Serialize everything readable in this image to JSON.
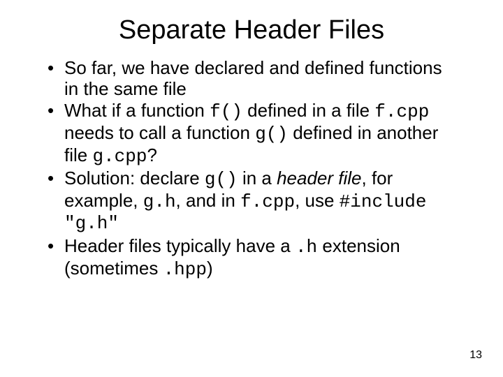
{
  "title": "Separate Header Files",
  "bullets": {
    "b1": {
      "t1": "So far, we have declared and defined functions in the same file"
    },
    "b2": {
      "t1": "What if a function ",
      "code1": "f()",
      "t2": " defined in a file ",
      "code2": "f.cpp",
      "t3": " needs to call a function ",
      "code3": "g()",
      "t4": " defined in another file ",
      "code4": "g.cpp",
      "t5": "?"
    },
    "b3": {
      "t1": "Solution: declare ",
      "code1": "g()",
      "t2": " in a ",
      "italic1": "header file",
      "t3": ", for example, ",
      "code2": "g.h",
      "t4": ", and in ",
      "code3": "f.cpp",
      "t5": ", use ",
      "code4": "#include \"g.h\""
    },
    "b4": {
      "t1": "Header files typically have a ",
      "code1": ".h",
      "t2": " extension (sometimes ",
      "code2": ".hpp",
      "t3": ")"
    }
  },
  "page_number": "13"
}
